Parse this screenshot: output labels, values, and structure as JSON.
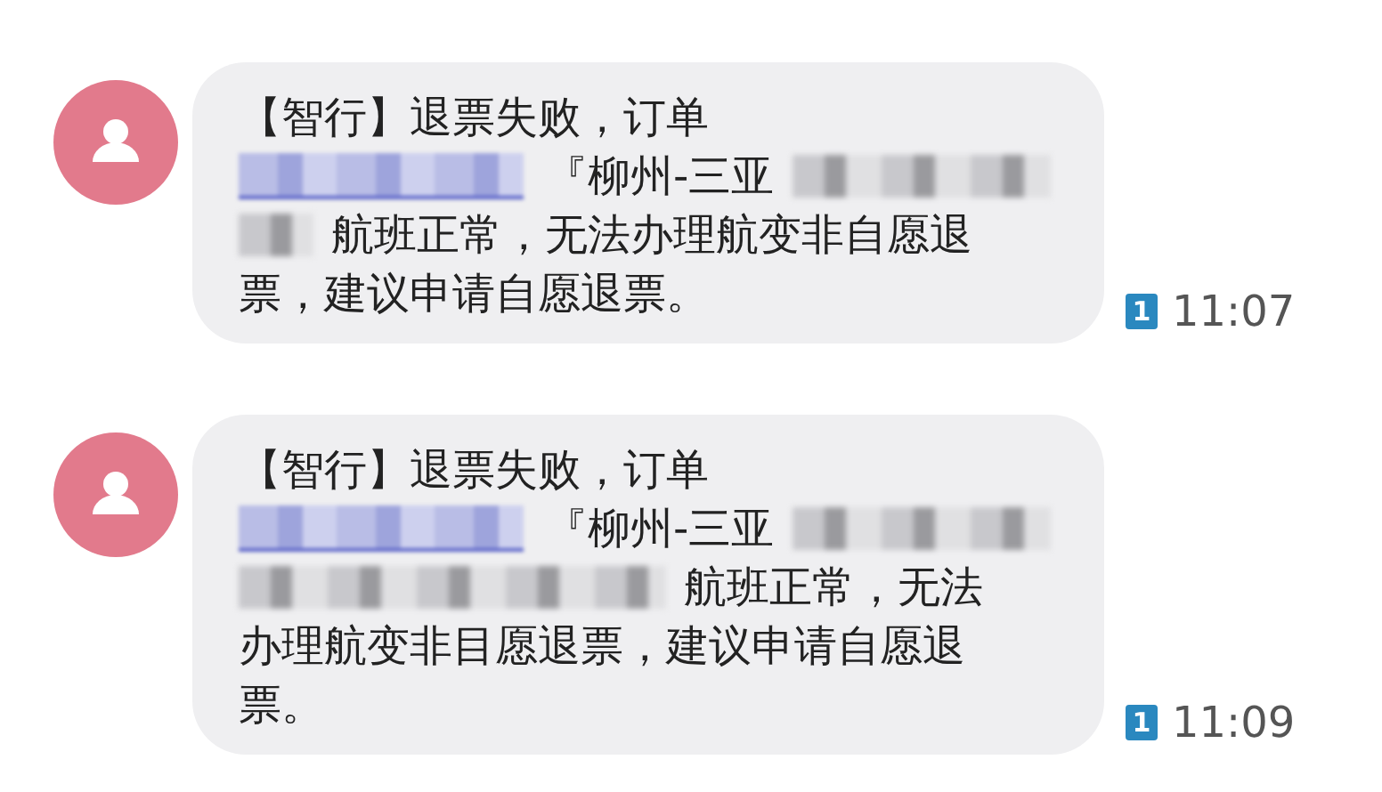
{
  "messages": [
    {
      "time": "11:07",
      "sim": "1",
      "lines": [
        [
          {
            "kind": "text",
            "text": "【智行】退票失败，订单"
          }
        ],
        [
          {
            "kind": "link_redaction"
          },
          {
            "kind": "text",
            "text": "『柳州-三亚"
          },
          {
            "kind": "redaction_wide"
          }
        ],
        [
          {
            "kind": "redaction_short"
          },
          {
            "kind": "text",
            "text": "航班正常，无法办理航变非自愿退"
          }
        ],
        [
          {
            "kind": "text",
            "text": "票，建议申请自愿退票。"
          }
        ]
      ]
    },
    {
      "time": "11:09",
      "sim": "1",
      "lines": [
        [
          {
            "kind": "text",
            "text": "【智行】退票失败，订单"
          }
        ],
        [
          {
            "kind": "link_redaction"
          },
          {
            "kind": "text",
            "text": "『柳州-三亚"
          },
          {
            "kind": "redaction_wide"
          }
        ],
        [
          {
            "kind": "redaction_long"
          },
          {
            "kind": "text",
            "text": "航班正常，无法"
          }
        ],
        [
          {
            "kind": "text",
            "text": "办理航变非目愿退票，建议申请自愿退"
          }
        ],
        [
          {
            "kind": "text",
            "text": "票。"
          }
        ]
      ]
    }
  ]
}
